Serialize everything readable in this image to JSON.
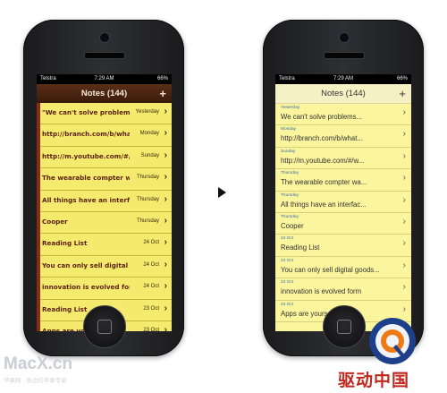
{
  "watermarks": {
    "left": "MacX.cn",
    "left_sub": "苹果网 · 身边的苹果专家",
    "right": "驱动中国"
  },
  "left_app": {
    "status": {
      "carrier": "Telstra",
      "time": "7:29 AM",
      "battery": "66%"
    },
    "title": "Notes (144)",
    "add": "+",
    "notes": [
      {
        "title": "\"We can't solve problems...",
        "date": "Yesterday"
      },
      {
        "title": "http://branch.com/b/what...",
        "date": "Monday"
      },
      {
        "title": "http://m.youtube.com/#/w...",
        "date": "Sunday"
      },
      {
        "title": "The wearable compter wa...",
        "date": "Thursday"
      },
      {
        "title": "All things have an interfac...",
        "date": "Thursday"
      },
      {
        "title": "Cooper",
        "date": "Thursday"
      },
      {
        "title": "Reading List",
        "date": "24 Oct"
      },
      {
        "title": "You can only sell digital goods...",
        "date": "24 Oct"
      },
      {
        "title": "innovation is evolved form",
        "date": "24 Oct"
      },
      {
        "title": "Reading List",
        "date": "23 Oct"
      },
      {
        "title": "Apps are yours",
        "date": "23 Oct"
      }
    ],
    "chevron": "›"
  },
  "right_app": {
    "status": {
      "carrier": "Telstra",
      "time": "7:29 AM",
      "battery": "66%"
    },
    "title": "Notes (144)",
    "add": "+",
    "notes": [
      {
        "title": "We can't solve problems...",
        "date": "Yesterday"
      },
      {
        "title": "http://branch.com/b/what...",
        "date": "Monday"
      },
      {
        "title": "http://m.youtube.com/#/w...",
        "date": "Sunday"
      },
      {
        "title": "The wearable compter wa...",
        "date": "Thursday"
      },
      {
        "title": "All things have an interfac...",
        "date": "Thursday"
      },
      {
        "title": "Cooper",
        "date": "Thursday"
      },
      {
        "title": "Reading List",
        "date": "24 Oct"
      },
      {
        "title": "You can only sell digital goods...",
        "date": "24 Oct"
      },
      {
        "title": "innovation is evolved form",
        "date": "24 Oct"
      },
      {
        "title": "Apps are yours",
        "date": "23 Oct"
      }
    ],
    "chevron": "›"
  },
  "colors": {
    "old_paper": "#f4ea6e",
    "old_bar": "#4a2412",
    "new_paper": "#fbf59d",
    "date_blue": "#3a6fa8",
    "brand_red": "#c0281f"
  }
}
